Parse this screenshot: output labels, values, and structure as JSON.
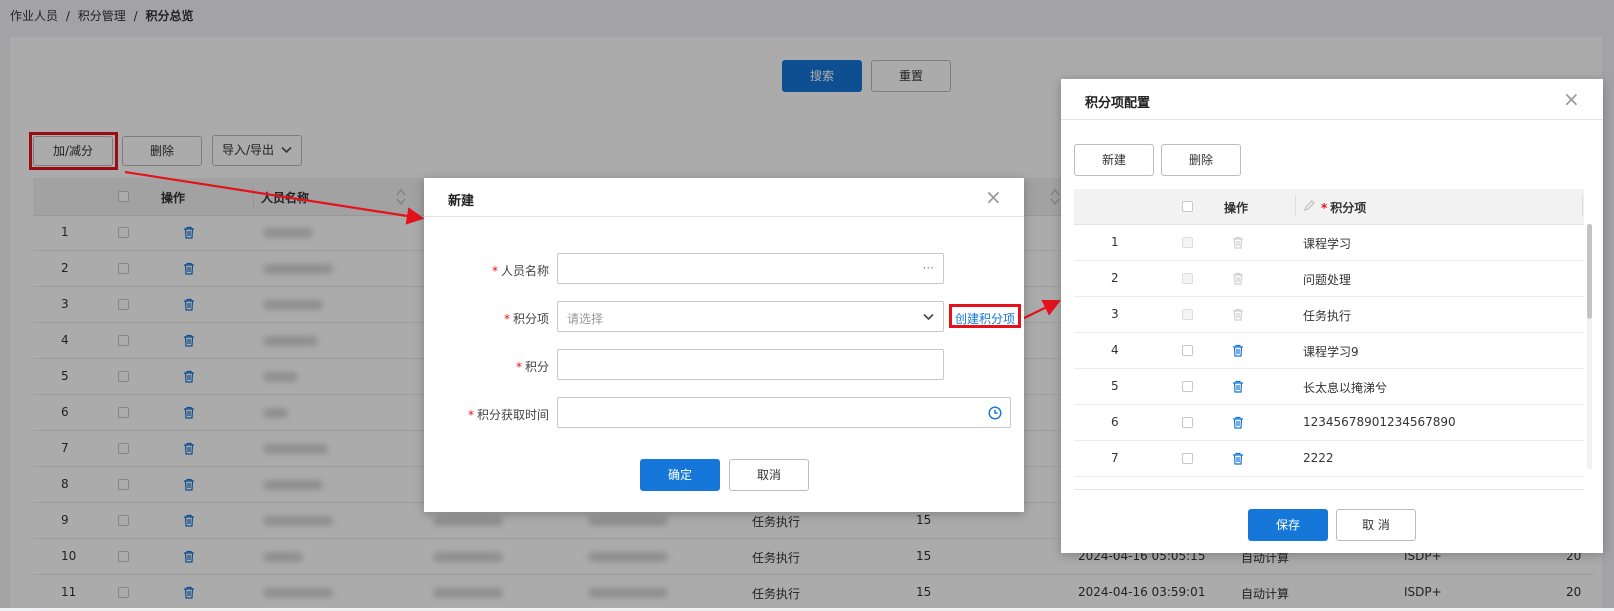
{
  "breadcrumb": {
    "items": [
      "作业人员",
      "积分管理",
      "积分总览"
    ],
    "sep": "/"
  },
  "filter": {
    "search_label": "搜索",
    "reset_label": "重置"
  },
  "toolbar": {
    "add_label": "加/减分",
    "delete_label": "删除",
    "import_label": "导入/导出"
  },
  "table": {
    "headers": {
      "op": "操作",
      "name": "人员名称"
    },
    "rows": [
      {
        "idx": "1"
      },
      {
        "idx": "2"
      },
      {
        "idx": "3"
      },
      {
        "idx": "4"
      },
      {
        "idx": "5"
      },
      {
        "idx": "6"
      },
      {
        "idx": "7"
      },
      {
        "idx": "8"
      },
      {
        "idx": "9",
        "item": "任务执行",
        "score": "15"
      },
      {
        "idx": "10",
        "item": "任务执行",
        "score": "15",
        "time": "2024-04-16 05:05:15",
        "type": "自动计算",
        "source": "ISDP+",
        "extra": "20"
      },
      {
        "idx": "11",
        "item": "任务执行",
        "score": "15",
        "time": "2024-04-16 03:59:01",
        "type": "自动计算",
        "source": "ISDP+",
        "extra": "20"
      }
    ]
  },
  "dialog_new": {
    "title": "新建",
    "fields": {
      "name_label": "人员名称",
      "item_label": "积分项",
      "item_placeholder": "请选择",
      "create_link": "创建积分项",
      "score_label": "积分",
      "time_label": "积分获取时间"
    },
    "ok_label": "确定",
    "cancel_label": "取消"
  },
  "dialog_config": {
    "title": "积分项配置",
    "new_label": "新建",
    "delete_label": "删除",
    "headers": {
      "op": "操作",
      "item": "积分项"
    },
    "rows": [
      {
        "idx": "1",
        "name": "课程学习"
      },
      {
        "idx": "2",
        "name": "问题处理"
      },
      {
        "idx": "3",
        "name": "任务执行"
      },
      {
        "idx": "4",
        "name": "课程学习9"
      },
      {
        "idx": "5",
        "name": "长太息以掩涕兮"
      },
      {
        "idx": "6",
        "name": "12345678901234567890"
      },
      {
        "idx": "7",
        "name": "2222"
      }
    ],
    "save_label": "保存",
    "cancel_label": "取 消"
  },
  "colors": {
    "primary": "#1677d9",
    "annotation": "#e5121b"
  }
}
